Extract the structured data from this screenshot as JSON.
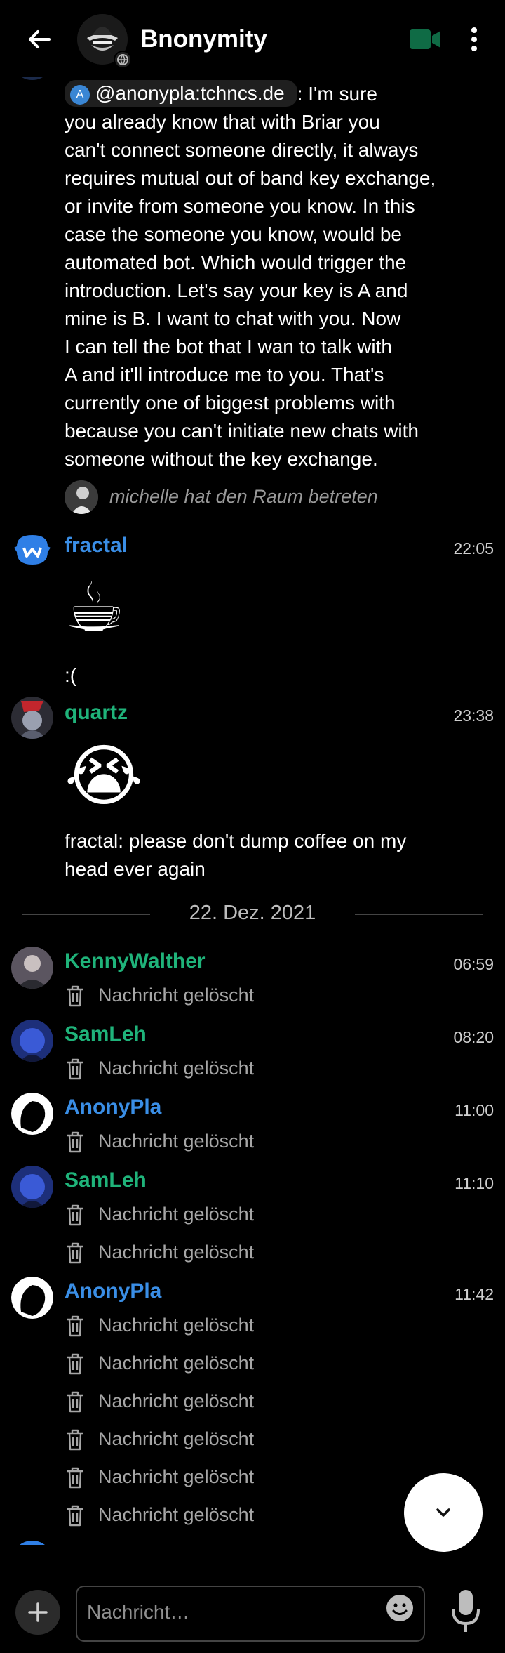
{
  "header": {
    "title": "Bnonymity"
  },
  "first_message": {
    "mention": "@anonypla:tchncs.de",
    "mention_badge": "A",
    "lines": [
      ": I'm sure",
      "you already know that with Briar you",
      "can't connect someone directly, it always",
      "requires mutual out of band key exchange,",
      "or invite from someone you know. In this",
      "case the someone you know, would be",
      "automated bot. Which would trigger the",
      "introduction. Let's say your key is A and",
      "mine is B. I want to chat with you. Now",
      "I can tell the bot that I wan to talk with",
      "A and it'll introduce me to you. That's",
      "currently one of biggest problems with",
      "because you can't initiate new chats with",
      "someone without the key exchange."
    ]
  },
  "state_event": {
    "text": "michelle hat den Raum betreten"
  },
  "messages": [
    {
      "sender": "fractal",
      "time": "22:05",
      "emoji": "☕",
      "text": ":("
    },
    {
      "sender": "quartz",
      "time": "23:38",
      "emoji": "😭",
      "text_lines": [
        "fractal: please don't dump coffee on my",
        "head ever again"
      ]
    }
  ],
  "date_divider": "22. Dez. 2021",
  "deleted_groups": [
    {
      "sender": "KennyWalther",
      "time": "06:59",
      "count": 1
    },
    {
      "sender": "SamLeh",
      "time": "08:20",
      "count": 1
    },
    {
      "sender": "AnonyPla",
      "time": "11:00",
      "count": 1
    },
    {
      "sender": "SamLeh",
      "time": "11:10",
      "count": 2
    },
    {
      "sender": "AnonyPla",
      "time": "11:42",
      "count": 6
    }
  ],
  "deleted_label": "Nachricht gelöscht",
  "composer": {
    "placeholder": "Nachricht…"
  },
  "colors": {
    "green_sender": "#1fb37a",
    "blue_sender": "#3a8ee6",
    "video_icon": "#0f6b45"
  },
  "icons": {
    "back": "arrow-left-icon",
    "video": "video-camera-icon",
    "more": "more-vertical-icon",
    "trash": "trash-icon",
    "scroll_down": "chevron-down-icon",
    "add": "plus-icon",
    "emoji": "emoji-icon",
    "mic": "microphone-icon"
  }
}
